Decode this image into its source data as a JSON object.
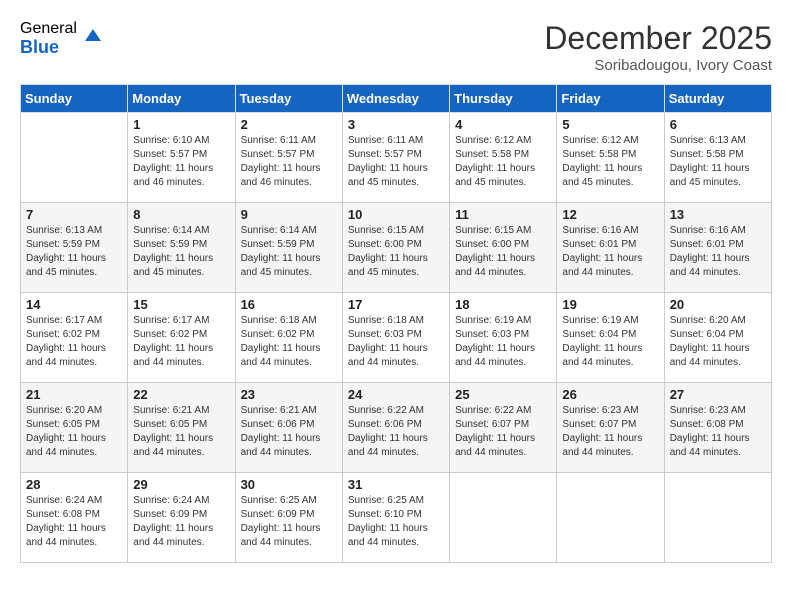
{
  "logo": {
    "general": "General",
    "blue": "Blue"
  },
  "title": "December 2025",
  "subtitle": "Soribadougou, Ivory Coast",
  "weekdays": [
    "Sunday",
    "Monday",
    "Tuesday",
    "Wednesday",
    "Thursday",
    "Friday",
    "Saturday"
  ],
  "weeks": [
    [
      {
        "day": "",
        "sunrise": "",
        "sunset": "",
        "daylight": ""
      },
      {
        "day": "1",
        "sunrise": "Sunrise: 6:10 AM",
        "sunset": "Sunset: 5:57 PM",
        "daylight": "Daylight: 11 hours and 46 minutes."
      },
      {
        "day": "2",
        "sunrise": "Sunrise: 6:11 AM",
        "sunset": "Sunset: 5:57 PM",
        "daylight": "Daylight: 11 hours and 46 minutes."
      },
      {
        "day": "3",
        "sunrise": "Sunrise: 6:11 AM",
        "sunset": "Sunset: 5:57 PM",
        "daylight": "Daylight: 11 hours and 45 minutes."
      },
      {
        "day": "4",
        "sunrise": "Sunrise: 6:12 AM",
        "sunset": "Sunset: 5:58 PM",
        "daylight": "Daylight: 11 hours and 45 minutes."
      },
      {
        "day": "5",
        "sunrise": "Sunrise: 6:12 AM",
        "sunset": "Sunset: 5:58 PM",
        "daylight": "Daylight: 11 hours and 45 minutes."
      },
      {
        "day": "6",
        "sunrise": "Sunrise: 6:13 AM",
        "sunset": "Sunset: 5:58 PM",
        "daylight": "Daylight: 11 hours and 45 minutes."
      }
    ],
    [
      {
        "day": "7",
        "sunrise": "Sunrise: 6:13 AM",
        "sunset": "Sunset: 5:59 PM",
        "daylight": "Daylight: 11 hours and 45 minutes."
      },
      {
        "day": "8",
        "sunrise": "Sunrise: 6:14 AM",
        "sunset": "Sunset: 5:59 PM",
        "daylight": "Daylight: 11 hours and 45 minutes."
      },
      {
        "day": "9",
        "sunrise": "Sunrise: 6:14 AM",
        "sunset": "Sunset: 5:59 PM",
        "daylight": "Daylight: 11 hours and 45 minutes."
      },
      {
        "day": "10",
        "sunrise": "Sunrise: 6:15 AM",
        "sunset": "Sunset: 6:00 PM",
        "daylight": "Daylight: 11 hours and 45 minutes."
      },
      {
        "day": "11",
        "sunrise": "Sunrise: 6:15 AM",
        "sunset": "Sunset: 6:00 PM",
        "daylight": "Daylight: 11 hours and 44 minutes."
      },
      {
        "day": "12",
        "sunrise": "Sunrise: 6:16 AM",
        "sunset": "Sunset: 6:01 PM",
        "daylight": "Daylight: 11 hours and 44 minutes."
      },
      {
        "day": "13",
        "sunrise": "Sunrise: 6:16 AM",
        "sunset": "Sunset: 6:01 PM",
        "daylight": "Daylight: 11 hours and 44 minutes."
      }
    ],
    [
      {
        "day": "14",
        "sunrise": "Sunrise: 6:17 AM",
        "sunset": "Sunset: 6:02 PM",
        "daylight": "Daylight: 11 hours and 44 minutes."
      },
      {
        "day": "15",
        "sunrise": "Sunrise: 6:17 AM",
        "sunset": "Sunset: 6:02 PM",
        "daylight": "Daylight: 11 hours and 44 minutes."
      },
      {
        "day": "16",
        "sunrise": "Sunrise: 6:18 AM",
        "sunset": "Sunset: 6:02 PM",
        "daylight": "Daylight: 11 hours and 44 minutes."
      },
      {
        "day": "17",
        "sunrise": "Sunrise: 6:18 AM",
        "sunset": "Sunset: 6:03 PM",
        "daylight": "Daylight: 11 hours and 44 minutes."
      },
      {
        "day": "18",
        "sunrise": "Sunrise: 6:19 AM",
        "sunset": "Sunset: 6:03 PM",
        "daylight": "Daylight: 11 hours and 44 minutes."
      },
      {
        "day": "19",
        "sunrise": "Sunrise: 6:19 AM",
        "sunset": "Sunset: 6:04 PM",
        "daylight": "Daylight: 11 hours and 44 minutes."
      },
      {
        "day": "20",
        "sunrise": "Sunrise: 6:20 AM",
        "sunset": "Sunset: 6:04 PM",
        "daylight": "Daylight: 11 hours and 44 minutes."
      }
    ],
    [
      {
        "day": "21",
        "sunrise": "Sunrise: 6:20 AM",
        "sunset": "Sunset: 6:05 PM",
        "daylight": "Daylight: 11 hours and 44 minutes."
      },
      {
        "day": "22",
        "sunrise": "Sunrise: 6:21 AM",
        "sunset": "Sunset: 6:05 PM",
        "daylight": "Daylight: 11 hours and 44 minutes."
      },
      {
        "day": "23",
        "sunrise": "Sunrise: 6:21 AM",
        "sunset": "Sunset: 6:06 PM",
        "daylight": "Daylight: 11 hours and 44 minutes."
      },
      {
        "day": "24",
        "sunrise": "Sunrise: 6:22 AM",
        "sunset": "Sunset: 6:06 PM",
        "daylight": "Daylight: 11 hours and 44 minutes."
      },
      {
        "day": "25",
        "sunrise": "Sunrise: 6:22 AM",
        "sunset": "Sunset: 6:07 PM",
        "daylight": "Daylight: 11 hours and 44 minutes."
      },
      {
        "day": "26",
        "sunrise": "Sunrise: 6:23 AM",
        "sunset": "Sunset: 6:07 PM",
        "daylight": "Daylight: 11 hours and 44 minutes."
      },
      {
        "day": "27",
        "sunrise": "Sunrise: 6:23 AM",
        "sunset": "Sunset: 6:08 PM",
        "daylight": "Daylight: 11 hours and 44 minutes."
      }
    ],
    [
      {
        "day": "28",
        "sunrise": "Sunrise: 6:24 AM",
        "sunset": "Sunset: 6:08 PM",
        "daylight": "Daylight: 11 hours and 44 minutes."
      },
      {
        "day": "29",
        "sunrise": "Sunrise: 6:24 AM",
        "sunset": "Sunset: 6:09 PM",
        "daylight": "Daylight: 11 hours and 44 minutes."
      },
      {
        "day": "30",
        "sunrise": "Sunrise: 6:25 AM",
        "sunset": "Sunset: 6:09 PM",
        "daylight": "Daylight: 11 hours and 44 minutes."
      },
      {
        "day": "31",
        "sunrise": "Sunrise: 6:25 AM",
        "sunset": "Sunset: 6:10 PM",
        "daylight": "Daylight: 11 hours and 44 minutes."
      },
      {
        "day": "",
        "sunrise": "",
        "sunset": "",
        "daylight": ""
      },
      {
        "day": "",
        "sunrise": "",
        "sunset": "",
        "daylight": ""
      },
      {
        "day": "",
        "sunrise": "",
        "sunset": "",
        "daylight": ""
      }
    ]
  ]
}
